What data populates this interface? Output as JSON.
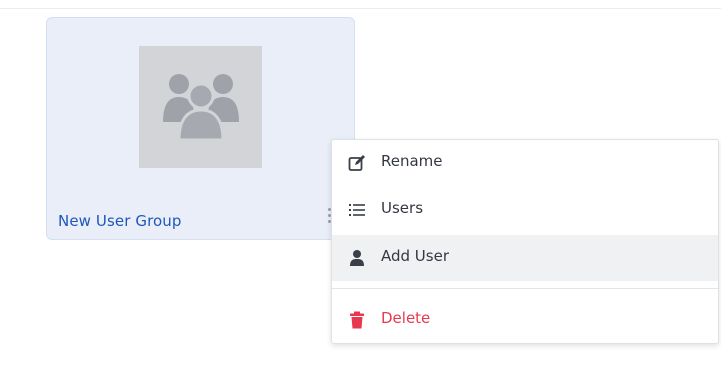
{
  "group_card": {
    "name": "New User Group",
    "thumbnail_icon": "user-group-icon",
    "more_icon": "kebab-vertical-icon"
  },
  "context_menu": {
    "items": [
      {
        "label": "Rename",
        "icon": "edit-icon",
        "color": "#333842"
      },
      {
        "label": "Users",
        "icon": "list-icon",
        "color": "#333842"
      },
      {
        "label": "Add User",
        "icon": "user-icon",
        "color": "#333842",
        "hovered": true
      },
      {
        "label": "Delete",
        "icon": "trash-icon",
        "color": "#e8384f"
      }
    ]
  },
  "colors": {
    "card_background": "#e9eef9",
    "link_blue": "#1f57b8",
    "danger_red": "#e8384f",
    "hover_background": "#f0f1f3"
  }
}
